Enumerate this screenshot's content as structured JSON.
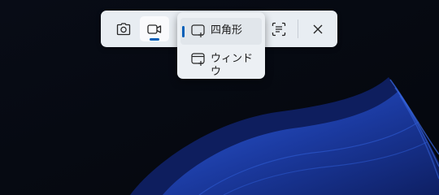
{
  "toolbar": {
    "tools": [
      {
        "icon": "camera-icon",
        "label": ""
      },
      {
        "icon": "video-icon",
        "label": "",
        "selected": true
      },
      {
        "icon": "text-extract-icon",
        "label": ""
      },
      {
        "icon": "close-icon",
        "label": ""
      }
    ]
  },
  "dropdown": {
    "items": [
      {
        "label": "四角形",
        "icon": "rectangle-capture-icon",
        "selected": true
      },
      {
        "label": "ウィンドウ",
        "icon": "window-capture-icon",
        "selected": false
      }
    ]
  },
  "colors": {
    "accent": "#005fb8",
    "toolbar_bg": "#e8edf2",
    "menu_bg": "#ecf0f4",
    "wallpaper_dark": "#05080f",
    "wallpaper_blue": "#1d3a9c"
  }
}
